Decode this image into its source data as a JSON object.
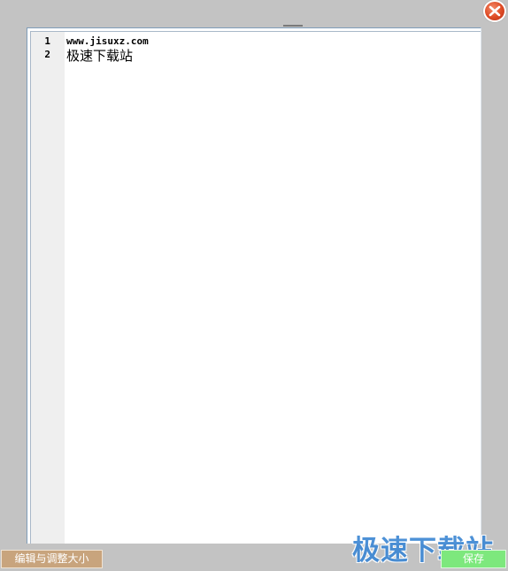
{
  "editor": {
    "lines": [
      {
        "number": "1",
        "text": "www.jisuxz.com"
      },
      {
        "number": "2",
        "text": "极速下载站"
      }
    ]
  },
  "buttons": {
    "edit_resize_label": "编辑与调整大小",
    "save_label": "保存",
    "close_icon": "close-icon"
  },
  "watermark": {
    "text": "极速下载站"
  },
  "colors": {
    "background": "#c3c3c3",
    "edit_resize_button": "#c8a47d",
    "save_button": "#7de87d",
    "close_button": "#dd4a24",
    "watermark": "#3e88d4"
  }
}
